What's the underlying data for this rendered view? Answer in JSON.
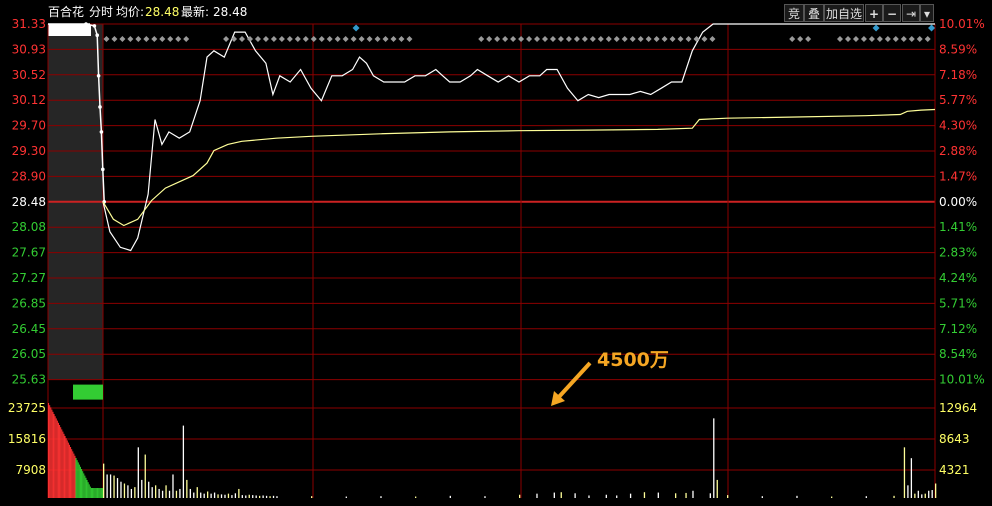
{
  "header": {
    "stock_name": "百合花",
    "mode": "分时",
    "avg_label": "均价:",
    "avg_value": "28.48",
    "latest_label": "最新:",
    "latest_value": "28.48"
  },
  "toolbar": {
    "bid_label": "竞",
    "overlay_label": "叠",
    "add_watch_label": "加自选",
    "zoom_in_label": "+",
    "zoom_out_label": "−",
    "end_label": "⇥",
    "menu_label": "▾"
  },
  "annotation": {
    "text": "4500万"
  },
  "colors": {
    "up": "#ff3333",
    "down": "#33cc33",
    "grid": "#8b0000",
    "price_line": "#ffffff",
    "avg_line": "#ffff99",
    "annotation": "#f5a623",
    "marker": "#3399cc"
  },
  "chart_data": {
    "type": "line",
    "title": "",
    "prev_close": 28.48,
    "price_axis": {
      "left_labels": [
        "31.33",
        "30.93",
        "30.52",
        "30.12",
        "29.70",
        "29.30",
        "28.90",
        "28.48",
        "28.08",
        "27.67",
        "27.27",
        "26.85",
        "26.45",
        "26.05",
        "25.63"
      ],
      "right_labels": [
        "10.01%",
        "8.59%",
        "7.18%",
        "5.77%",
        "4.30%",
        "2.88%",
        "1.47%",
        "0.00%",
        "1.41%",
        "2.83%",
        "4.24%",
        "5.71%",
        "7.12%",
        "8.54%",
        "10.01%"
      ],
      "ylim": [
        25.63,
        31.33
      ]
    },
    "volume_axis": {
      "left_labels": [
        "23725",
        "15816",
        "7908"
      ],
      "right_labels": [
        "12964",
        "8643",
        "4321"
      ]
    },
    "series": [
      {
        "values_kind": "price",
        "points": [
          [
            0,
            28.48
          ],
          [
            2,
            28.0
          ],
          [
            5,
            27.75
          ],
          [
            8,
            27.7
          ],
          [
            10,
            27.9
          ],
          [
            13,
            28.6
          ],
          [
            15,
            29.8
          ],
          [
            17,
            29.4
          ],
          [
            19,
            29.6
          ],
          [
            22,
            29.5
          ],
          [
            25,
            29.6
          ],
          [
            28,
            30.1
          ],
          [
            30,
            30.8
          ],
          [
            32,
            30.9
          ],
          [
            35,
            30.8
          ],
          [
            38,
            31.2
          ],
          [
            41,
            31.2
          ],
          [
            44,
            30.9
          ],
          [
            47,
            30.7
          ],
          [
            49,
            30.2
          ],
          [
            51,
            30.5
          ],
          [
            54,
            30.4
          ],
          [
            57,
            30.6
          ],
          [
            60,
            30.3
          ],
          [
            63,
            30.1
          ],
          [
            66,
            30.5
          ],
          [
            69,
            30.5
          ],
          [
            72,
            30.6
          ],
          [
            74,
            30.8
          ],
          [
            76,
            30.7
          ],
          [
            78,
            30.5
          ],
          [
            81,
            30.4
          ],
          [
            84,
            30.4
          ],
          [
            87,
            30.4
          ],
          [
            90,
            30.5
          ],
          [
            93,
            30.5
          ],
          [
            96,
            30.6
          ],
          [
            98,
            30.5
          ],
          [
            100,
            30.4
          ],
          [
            103,
            30.4
          ],
          [
            106,
            30.5
          ],
          [
            108,
            30.6
          ],
          [
            111,
            30.5
          ],
          [
            114,
            30.4
          ],
          [
            117,
            30.5
          ],
          [
            120,
            30.4
          ],
          [
            123,
            30.5
          ],
          [
            126,
            30.5
          ],
          [
            128,
            30.6
          ],
          [
            131,
            30.6
          ],
          [
            134,
            30.3
          ],
          [
            137,
            30.1
          ],
          [
            140,
            30.2
          ],
          [
            143,
            30.15
          ],
          [
            146,
            30.2
          ],
          [
            149,
            30.2
          ],
          [
            152,
            30.2
          ],
          [
            155,
            30.25
          ],
          [
            158,
            30.2
          ],
          [
            161,
            30.3
          ],
          [
            164,
            30.4
          ],
          [
            167,
            30.4
          ],
          [
            170,
            30.9
          ],
          [
            173,
            31.2
          ],
          [
            176,
            31.33
          ],
          [
            240,
            31.33
          ]
        ]
      },
      {
        "values_kind": "average",
        "points": [
          [
            0,
            28.48
          ],
          [
            3,
            28.2
          ],
          [
            6,
            28.1
          ],
          [
            10,
            28.2
          ],
          [
            14,
            28.5
          ],
          [
            18,
            28.7
          ],
          [
            22,
            28.8
          ],
          [
            26,
            28.9
          ],
          [
            30,
            29.1
          ],
          [
            32,
            29.3
          ],
          [
            36,
            29.4
          ],
          [
            40,
            29.45
          ],
          [
            50,
            29.5
          ],
          [
            60,
            29.53
          ],
          [
            80,
            29.57
          ],
          [
            100,
            29.6
          ],
          [
            120,
            29.62
          ],
          [
            140,
            29.63
          ],
          [
            160,
            29.64
          ],
          [
            170,
            29.66
          ],
          [
            172,
            29.8
          ],
          [
            180,
            29.82
          ],
          [
            200,
            29.84
          ],
          [
            220,
            29.86
          ],
          [
            230,
            29.88
          ],
          [
            232,
            29.93
          ],
          [
            236,
            29.95
          ],
          [
            240,
            29.96
          ]
        ]
      }
    ],
    "volume_max": 31600,
    "volume": [
      [
        0,
        9500
      ],
      [
        1,
        6500
      ],
      [
        2,
        6500
      ],
      [
        3,
        6200
      ],
      [
        4,
        5500
      ],
      [
        5,
        4500
      ],
      [
        6,
        4000
      ],
      [
        7,
        3500
      ],
      [
        8,
        2500
      ],
      [
        9,
        3000
      ],
      [
        10,
        14000
      ],
      [
        11,
        5000
      ],
      [
        12,
        12000
      ],
      [
        13,
        4500
      ],
      [
        14,
        3000
      ],
      [
        15,
        3500
      ],
      [
        16,
        2500
      ],
      [
        17,
        2000
      ],
      [
        18,
        3500
      ],
      [
        19,
        2000
      ],
      [
        20,
        6500
      ],
      [
        21,
        2000
      ],
      [
        22,
        2500
      ],
      [
        23,
        20000
      ],
      [
        24,
        5000
      ],
      [
        25,
        2500
      ],
      [
        26,
        1500
      ],
      [
        27,
        3000
      ],
      [
        28,
        1500
      ],
      [
        29,
        1200
      ],
      [
        30,
        1800
      ],
      [
        31,
        1200
      ],
      [
        32,
        1500
      ],
      [
        33,
        1000
      ],
      [
        34,
        1000
      ],
      [
        35,
        900
      ],
      [
        36,
        1200
      ],
      [
        37,
        800
      ],
      [
        38,
        1300
      ],
      [
        39,
        2500
      ],
      [
        40,
        800
      ],
      [
        41,
        700
      ],
      [
        42,
        900
      ],
      [
        43,
        800
      ],
      [
        44,
        700
      ],
      [
        45,
        600
      ],
      [
        46,
        700
      ],
      [
        47,
        600
      ],
      [
        48,
        500
      ],
      [
        49,
        600
      ],
      [
        50,
        500
      ],
      [
        60,
        500
      ],
      [
        70,
        400
      ],
      [
        80,
        500
      ],
      [
        90,
        400
      ],
      [
        100,
        600
      ],
      [
        110,
        500
      ],
      [
        120,
        900
      ],
      [
        125,
        1200
      ],
      [
        130,
        1500
      ],
      [
        132,
        1600
      ],
      [
        136,
        1300
      ],
      [
        140,
        700
      ],
      [
        145,
        900
      ],
      [
        148,
        700
      ],
      [
        152,
        1200
      ],
      [
        156,
        1600
      ],
      [
        160,
        1500
      ],
      [
        165,
        1300
      ],
      [
        168,
        1400
      ],
      [
        170,
        2000
      ],
      [
        175,
        1300
      ],
      [
        176,
        22000
      ],
      [
        177,
        5000
      ],
      [
        180,
        800
      ],
      [
        190,
        500
      ],
      [
        200,
        600
      ],
      [
        210,
        400
      ],
      [
        220,
        500
      ],
      [
        228,
        600
      ],
      [
        231,
        14000
      ],
      [
        232,
        3500
      ],
      [
        233,
        11000
      ],
      [
        234,
        1200
      ],
      [
        235,
        2000
      ],
      [
        236,
        1000
      ],
      [
        237,
        1200
      ],
      [
        238,
        2000
      ],
      [
        239,
        2200
      ],
      [
        240,
        4000
      ]
    ]
  }
}
